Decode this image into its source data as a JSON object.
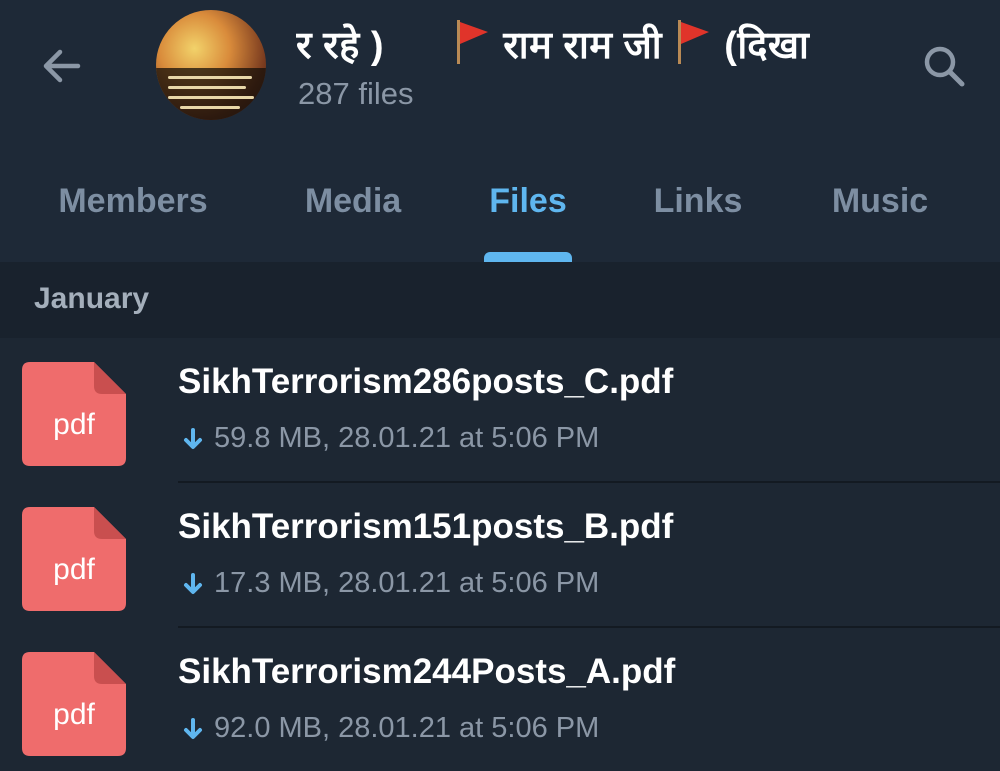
{
  "header": {
    "title_start": "र रहे )",
    "title_mid": "राम राम जी",
    "title_end": "(दिखा",
    "subtitle": "287 files",
    "back_icon": "arrow-left-icon",
    "search_icon": "search-icon"
  },
  "tabs": [
    {
      "label": "Members",
      "active": false
    },
    {
      "label": "Media",
      "active": false
    },
    {
      "label": "Files",
      "active": true
    },
    {
      "label": "Links",
      "active": false
    },
    {
      "label": "Music",
      "active": false
    }
  ],
  "section": {
    "label": "January"
  },
  "files": [
    {
      "name": "SikhTerrorism286posts_C.pdf",
      "meta": "59.8 MB, 28.01.21 at 5:06 PM",
      "ext": "pdf"
    },
    {
      "name": "SikhTerrorism151posts_B.pdf",
      "meta": "17.3 MB, 28.01.21 at 5:06 PM",
      "ext": "pdf"
    },
    {
      "name": "SikhTerrorism244Posts_A.pdf",
      "meta": "92.0 MB, 28.01.21 at 5:06 PM",
      "ext": "pdf"
    }
  ],
  "colors": {
    "background": "#1d2733",
    "header": "#1e2937",
    "accent": "#5fb6ef",
    "pdf_icon": "#ef6c6c",
    "muted_text": "#8b97a6",
    "flag": "#e0342a"
  }
}
